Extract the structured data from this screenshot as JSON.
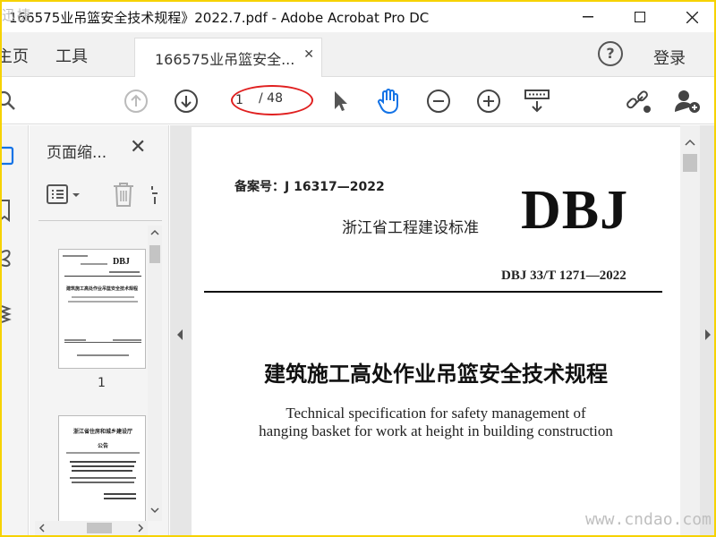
{
  "window": {
    "title": "166575业吊篮安全技术规程》2022.7.pdf - Adobe Acrobat Pro DC",
    "overlay_logo_text": "迅捷"
  },
  "menu": {
    "home": "主页",
    "tools": "工具",
    "tab_label": "166575业吊篮安全...",
    "help": "?",
    "login": "登录"
  },
  "toolbar": {
    "page_current": "1",
    "page_total": "/ 48"
  },
  "thumbnails": {
    "title": "页面缩...",
    "items": [
      {
        "page_label": "1",
        "mini_header": "DBJ",
        "mini_title": "建筑施工高处作业吊篮安全技术规程"
      },
      {
        "mini_header": "浙江省住房和城乡建设厅",
        "mini_title": "公告"
      }
    ]
  },
  "document": {
    "record_no": "备案号：J 16317—2022",
    "standard_org": "浙江省工程建设标准",
    "logo": "DBJ",
    "std_code": "DBJ 33/T 1271—2022",
    "title_cn": "建筑施工高处作业吊篮安全技术规程",
    "title_en_line1": "Technical specification for safety management of",
    "title_en_line2": "hanging basket for work at height in building construction"
  },
  "watermark": "www.cndao.com",
  "colors": {
    "frame": "#f6d200",
    "highlight_oval": "#e02020",
    "accent_blue": "#1473e6"
  }
}
